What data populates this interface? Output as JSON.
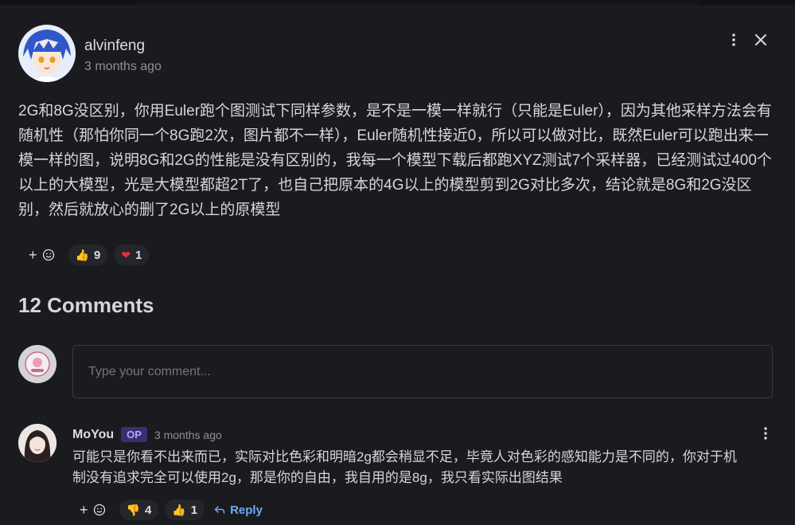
{
  "post": {
    "author": "alvinfeng",
    "time": "3 months ago",
    "body": "2G和8G没区别，你用Euler跑个图测试下同样参数，是不是一模一样就行（只能是Euler），因为其他采样方法会有随机性（那怕你同一个8G跑2次，图片都不一样），Euler随机性接近0，所以可以做对比，既然Euler可以跑出来一模一样的图，说明8G和2G的性能是没有区别的，我每一个模型下载后都跑XYZ测试7个采样器，已经测试过400个以上的大模型，光是大模型都超2T了，也自己把原本的4G以上的模型剪到2G对比多次，结论就是8G和2G没区别，然后就放心的删了2G以上的原模型",
    "reactions": {
      "add_icon": "add-reaction-icon",
      "thumbs_up_count": "9",
      "heart_count": "1"
    }
  },
  "comments_section": {
    "title": "12 Comments",
    "input_placeholder": "Type your comment..."
  },
  "comments": [
    {
      "author": "MoYou",
      "badge": "OP",
      "time": "3 months ago",
      "body": "可能只是你看不出来而已，实际对比色彩和明暗2g都会稍显不足，毕竟人对色彩的感知能力是不同的，你对于机制没有追求完全可以使用2g，那是你的自由，我自用的是8g，我只看实际出图结果",
      "thumbs_down_count": "4",
      "thumbs_up_count": "1",
      "reply_label": "Reply"
    }
  ],
  "colors": {
    "background": "#1a1b1e",
    "accent": "#6ea8f7",
    "op_badge": "#3b2f73",
    "heart": "#e03131"
  }
}
